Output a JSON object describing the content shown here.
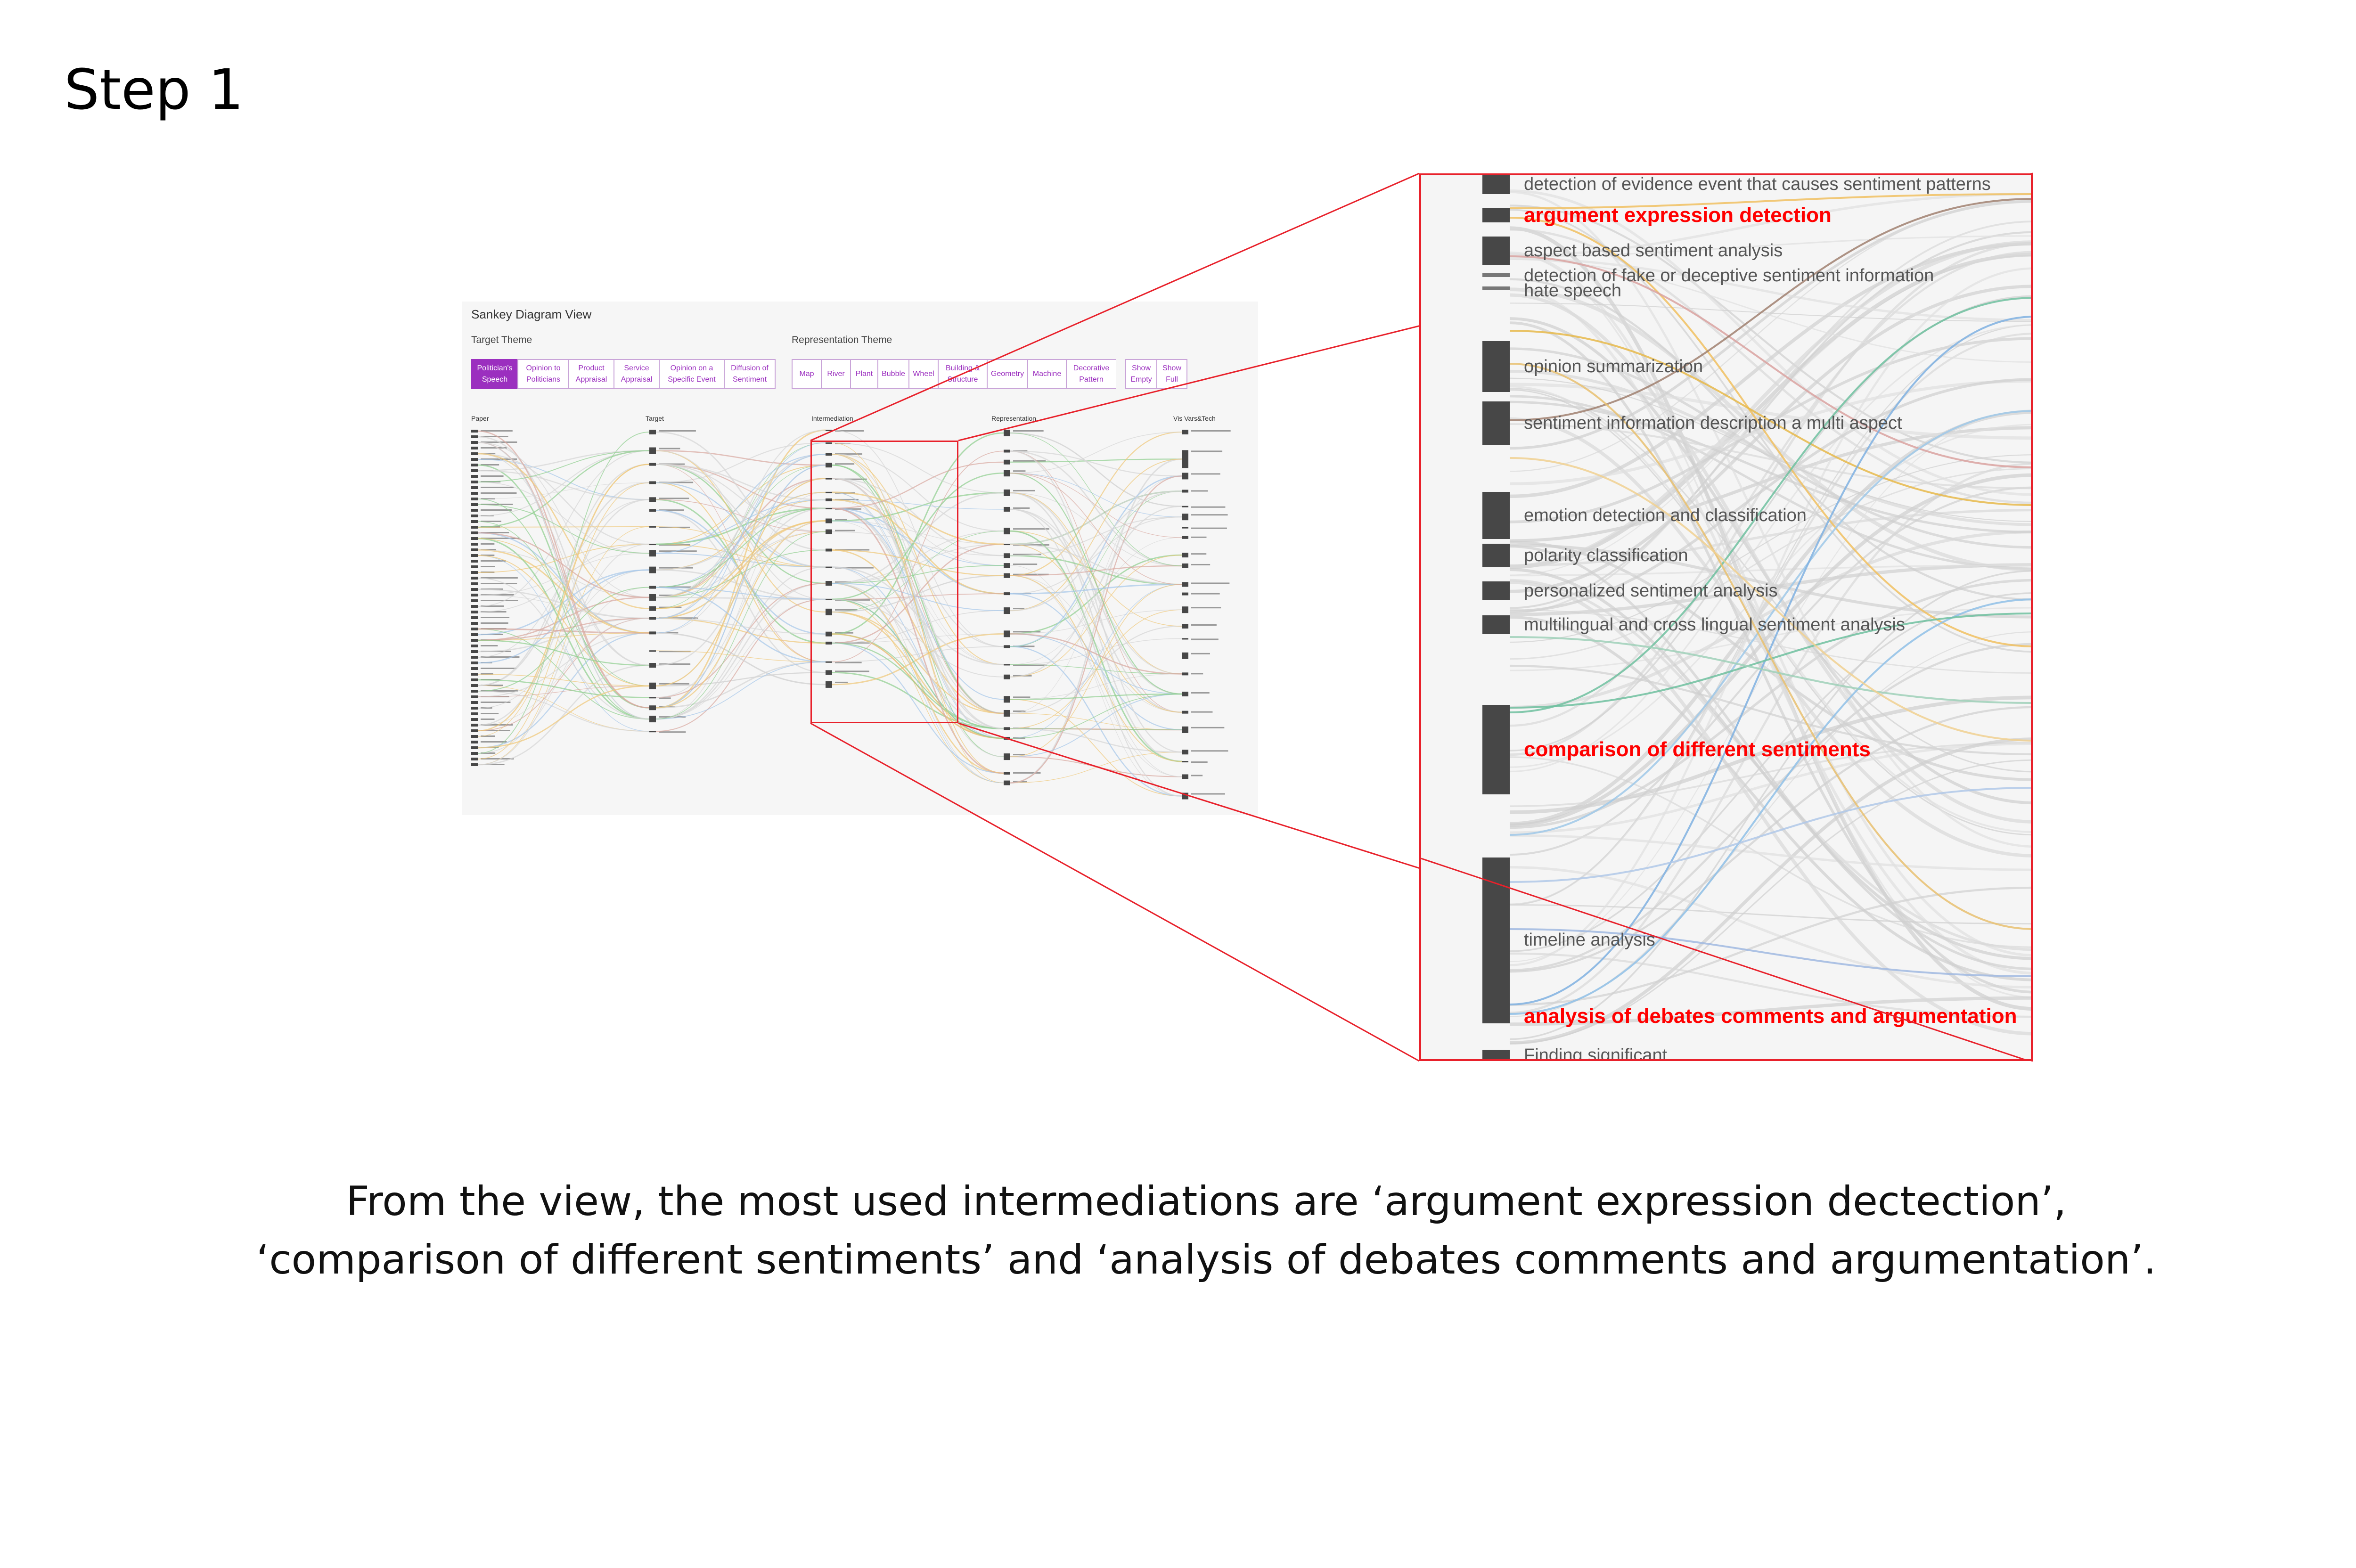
{
  "step_title": "Step 1",
  "view": {
    "title": "Sankey Diagram View",
    "target_theme_label": "Target Theme",
    "representation_theme_label": "Representation Theme",
    "target_theme_buttons": [
      {
        "label": "Politician's Speech",
        "active": true
      },
      {
        "label": "Opinion to Politicians",
        "active": false
      },
      {
        "label": "Product Appraisal",
        "active": false
      },
      {
        "label": "Service Appraisal",
        "active": false
      },
      {
        "label": "Opinion on a Specific Event",
        "active": false
      },
      {
        "label": "Diffusion of Sentiment",
        "active": false
      }
    ],
    "representation_theme_buttons": [
      {
        "label": "Map"
      },
      {
        "label": "River"
      },
      {
        "label": "Plant"
      },
      {
        "label": "Bubble"
      },
      {
        "label": "Wheel"
      },
      {
        "label": "Building & Structure"
      },
      {
        "label": "Geometry"
      },
      {
        "label": "Machine"
      },
      {
        "label": "Decorative Pattern"
      }
    ],
    "show_buttons": [
      {
        "label": "Show Empty"
      },
      {
        "label": "Show Full"
      }
    ],
    "column_headers": [
      "Paper",
      "Target",
      "Intermediation",
      "Representation",
      "Vis Vars&Tech"
    ]
  },
  "zoom": {
    "items": [
      {
        "label": "detection of evidence event that causes sentiment patterns",
        "highlighted": false
      },
      {
        "label": "argument expression detection",
        "highlighted": true
      },
      {
        "label": "aspect based sentiment analysis",
        "highlighted": false
      },
      {
        "label": "detection of fake or deceptive sentiment information",
        "highlighted": false
      },
      {
        "label": "hate speech",
        "highlighted": false
      },
      {
        "label": "opinion summarization",
        "highlighted": false
      },
      {
        "label": "sentiment information description a multi aspect",
        "highlighted": false
      },
      {
        "label": "emotion detection and classification",
        "highlighted": false
      },
      {
        "label": "polarity classification",
        "highlighted": false
      },
      {
        "label": "personalized sentiment analysis",
        "highlighted": false
      },
      {
        "label": "multilingual and cross lingual sentiment analysis",
        "highlighted": false
      },
      {
        "label": "comparison of different sentiments",
        "highlighted": true
      },
      {
        "label": "timeline analysis",
        "highlighted": false
      },
      {
        "label": "analysis of debates comments and argumentation",
        "highlighted": true
      },
      {
        "label": "Finding significant",
        "highlighted": false
      }
    ]
  },
  "caption": {
    "line1": "From the view, the most used intermediations are ‘argument expression dectection’,",
    "line2": "‘comparison of different sentiments’ and ‘analysis of debates comments and argumentation’."
  },
  "colors": {
    "highlight": "#ff0000",
    "frame": "#e8212b",
    "active_button": "#9b2fbf",
    "bar": "#474747"
  }
}
